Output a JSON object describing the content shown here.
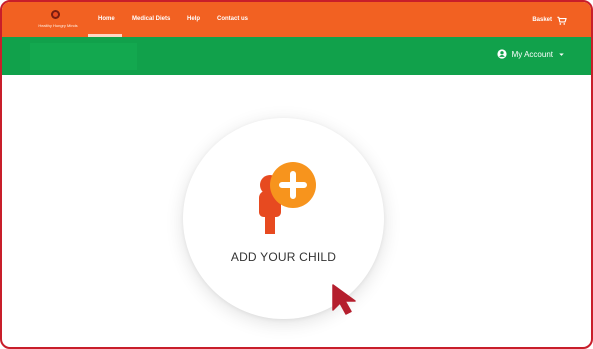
{
  "brand": {
    "name": "Healthy Hungry Minds"
  },
  "nav": {
    "items": [
      {
        "label": "Home"
      },
      {
        "label": "Medical Diets"
      },
      {
        "label": "Help"
      },
      {
        "label": "Contact us"
      }
    ],
    "active": "Home"
  },
  "basket": {
    "label": "Basket",
    "icon": "cart-icon"
  },
  "account": {
    "label": "My Account",
    "icon": "user-circle-icon",
    "dropdown_icon": "caret-down-icon"
  },
  "main": {
    "add_child_label": "ADD YOUR CHILD",
    "child_icon": "child-add-icon",
    "plus_icon": "plus-icon",
    "cursor_icon": "pointer-cursor-icon"
  },
  "colors": {
    "orange": "#f26122",
    "green": "#11a14b",
    "frame": "#c81e2a",
    "icon_orange": "#f7941d",
    "person_orange": "#e74a20"
  }
}
